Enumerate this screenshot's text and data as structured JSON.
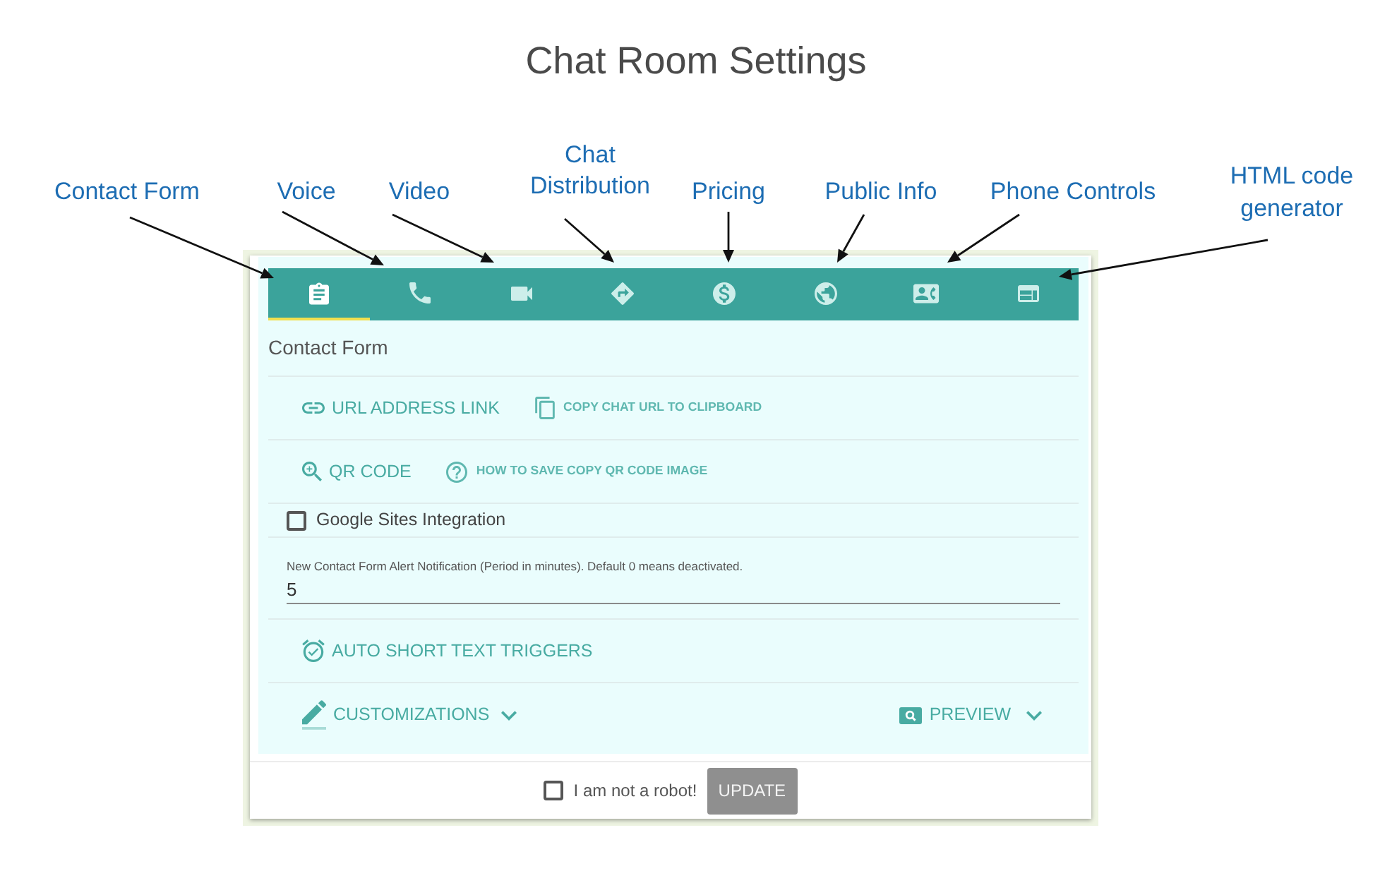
{
  "title": "Chat Room Settings",
  "callouts": [
    {
      "label": "Contact Form"
    },
    {
      "label": "Voice"
    },
    {
      "label": "Video"
    },
    {
      "label": "Chat Distribution"
    },
    {
      "label": "Pricing"
    },
    {
      "label": "Public Info"
    },
    {
      "label": "Phone Controls"
    },
    {
      "label": "HTML code generator"
    }
  ],
  "tabs": [
    {
      "selected": true
    },
    {
      "selected": false
    },
    {
      "selected": false
    },
    {
      "selected": false
    },
    {
      "selected": false
    },
    {
      "selected": false
    },
    {
      "selected": false
    },
    {
      "selected": false
    }
  ],
  "panel": {
    "heading": "Contact Form",
    "link_rows": [
      {
        "label": "URL ADDRESS LINK",
        "help": "COPY CHAT URL TO CLIPBOARD"
      },
      {
        "label": "QR CODE",
        "help": "HOW TO SAVE COPY QR CODE IMAGE"
      }
    ],
    "google_sites": {
      "label": "Google Sites Integration",
      "checked": false
    },
    "alert_field": {
      "label": "New Contact Form Alert Notification (Period in minutes). Default 0 means deactivated.",
      "value": "5"
    },
    "triggers": {
      "label": "AUTO SHORT TEXT TRIGGERS"
    },
    "customizations": {
      "label": "CUSTOMIZATIONS",
      "expanded": false
    },
    "preview": {
      "label": "PREVIEW",
      "expanded": false
    }
  },
  "footer": {
    "robot_check": {
      "label": "I am not a robot!",
      "checked": false
    },
    "update_button": {
      "label": "UPDATE",
      "disabled": true
    }
  }
}
